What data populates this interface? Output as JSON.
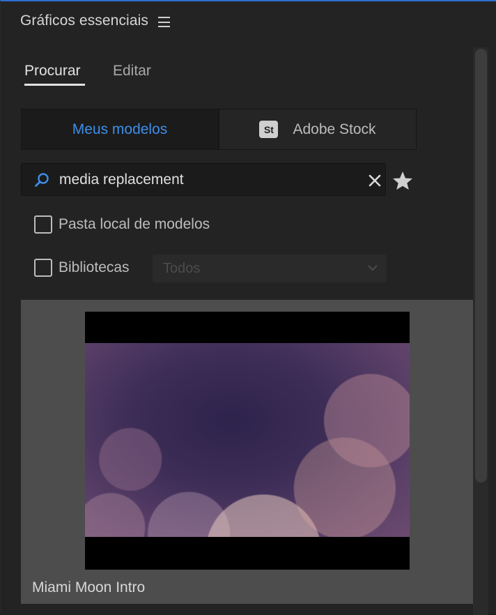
{
  "panel": {
    "title": "Gráficos essenciais",
    "menu_icon": "hamburger-icon"
  },
  "tabs": [
    {
      "label": "Procurar",
      "active": true
    },
    {
      "label": "Editar",
      "active": false
    }
  ],
  "source": {
    "my_templates_label": "Meus modelos",
    "my_templates_active": true,
    "stock_badge": "St",
    "adobe_stock_label": "Adobe Stock"
  },
  "search": {
    "value": "media replacement",
    "search_icon": "search-icon",
    "clear_icon": "close-icon",
    "favorite_icon": "star-icon"
  },
  "filters": {
    "local_folder_label": "Pasta local de modelos",
    "local_folder_checked": false,
    "libraries_label": "Bibliotecas",
    "libraries_checked": false,
    "libraries_select_value": "Todos"
  },
  "results": [
    {
      "title": "Miami Moon Intro"
    }
  ],
  "colors": {
    "accent_blue": "#3d8eea",
    "panel_bg": "#232323",
    "card_bg": "#4d4d4d"
  }
}
